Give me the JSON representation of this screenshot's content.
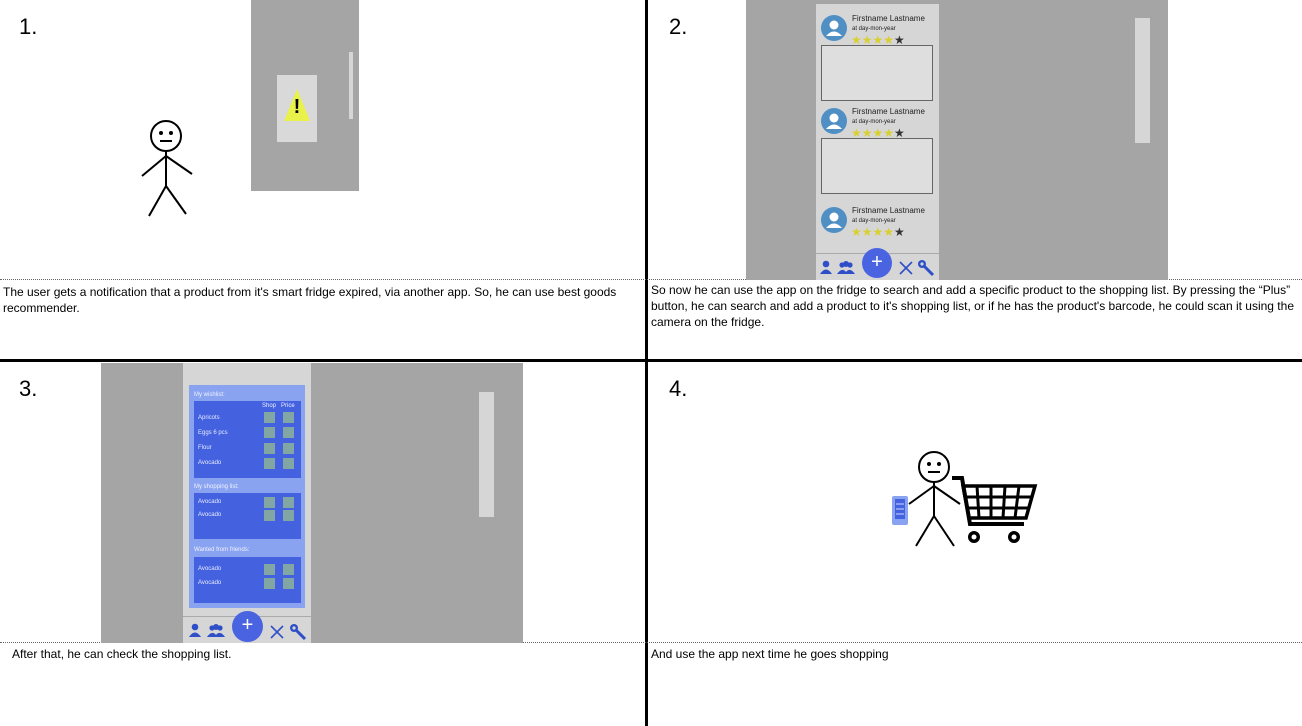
{
  "panels": [
    {
      "number": "1.",
      "caption": "The user gets a notification that a product from it's smart fridge expired, via another app. So, he can use best goods recommender."
    },
    {
      "number": "2.",
      "caption": "So now he can use the app on the fridge to search and add a specific product to the shopping list. By pressing the “Plus” button,  he can search and add a product to it's shopping list, or if he has the product's barcode, he could scan it using the camera on the fridge."
    },
    {
      "number": "3.",
      "caption": "After that, he can check the shopping list."
    },
    {
      "number": "4.",
      "caption": "And use the app next time he goes shopping"
    }
  ],
  "warning_symbol": "!",
  "reviews": [
    {
      "name": "Firstname Lastname",
      "date": "at day-mon-year",
      "rating": 4,
      "max": 5
    },
    {
      "name": "Firstname Lastname",
      "date": "at day-mon-year",
      "rating": 4,
      "max": 5
    },
    {
      "name": "Firstname Lastname",
      "date": "at day-mon-year",
      "rating": 4,
      "max": 5
    }
  ],
  "plus_label": "+",
  "shopping_app": {
    "wishlist_title": "My wishlist:",
    "col_shop": "Shop",
    "col_price": "Price",
    "wishlist_items": [
      "Apricots",
      "Eggs 6 pcs",
      "Flour",
      "Avocado"
    ],
    "shopping_title": "My shopping list:",
    "shopping_items": [
      "Avocado",
      "Avocado"
    ],
    "friends_title": "Wanted from friends:",
    "friends_items": [
      "Avocado",
      "Avocado"
    ]
  },
  "colors": {
    "fridge": "#a5a5a5",
    "app_bg": "#d6d6d6",
    "accent_blue": "#4a63e0",
    "warning": "#e8f24a",
    "star": "#d9d030"
  }
}
